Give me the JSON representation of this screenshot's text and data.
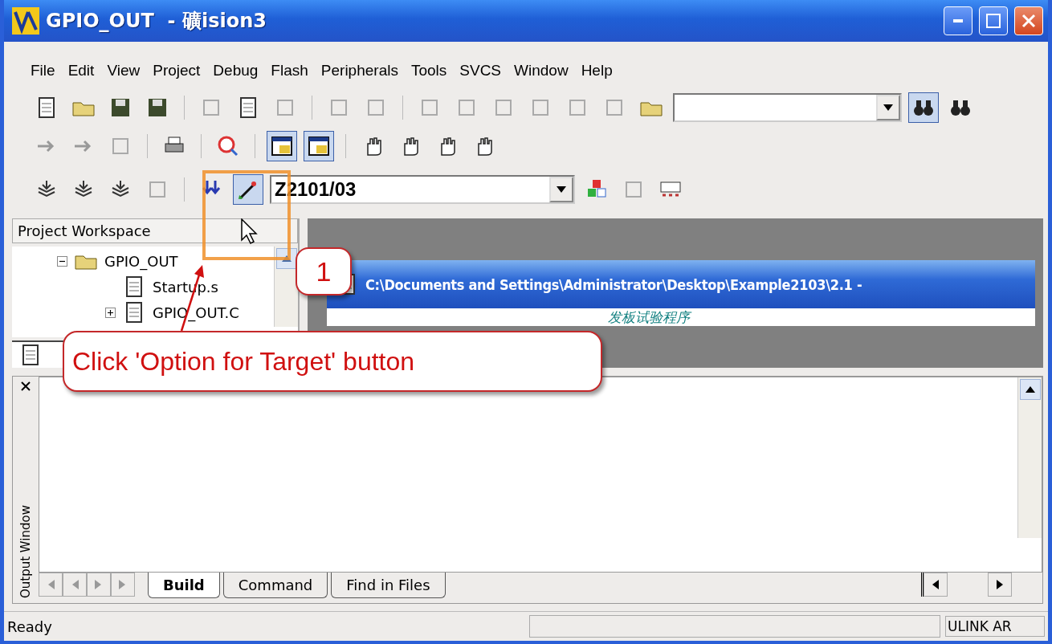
{
  "window": {
    "title": "GPIO_OUT  - 礦ision3"
  },
  "menu": [
    {
      "label": "File"
    },
    {
      "label": "Edit"
    },
    {
      "label": "View"
    },
    {
      "label": "Project"
    },
    {
      "label": "Debug"
    },
    {
      "label": "Flash"
    },
    {
      "label": "Peripherals"
    },
    {
      "label": "Tools"
    },
    {
      "label": "SVCS"
    },
    {
      "label": "Window"
    },
    {
      "label": "Help"
    }
  ],
  "toolbars": {
    "workspace_button": {
      "pressed": true
    },
    "output_button": {
      "pressed": true
    },
    "options_button": {
      "pressed": true
    },
    "find_button": {
      "pressed": true
    }
  },
  "target_select": {
    "value": "Z2101/03"
  },
  "workspace": {
    "title": "Project Workspace",
    "tree": [
      {
        "label": "GPIO_OUT",
        "expanded": true,
        "children": [
          {
            "label": "Startup.s"
          },
          {
            "label": "GPIO_OUT.C",
            "expanded": false
          }
        ]
      }
    ]
  },
  "editor": {
    "title": "C:\\Documents and Settings\\Administrator\\Desktop\\Example2103\\2.1 -",
    "line": "发板试验程序"
  },
  "output": {
    "title": "Output Window",
    "tabs": [
      {
        "label": "Build",
        "selected": true
      },
      {
        "label": "Command",
        "selected": false
      },
      {
        "label": "Find in Files",
        "selected": false
      }
    ]
  },
  "status_bar": {
    "text": "Ready",
    "target": "ULINK AR"
  },
  "callout": {
    "number": "1",
    "text": "Click 'Option for Target' button"
  }
}
